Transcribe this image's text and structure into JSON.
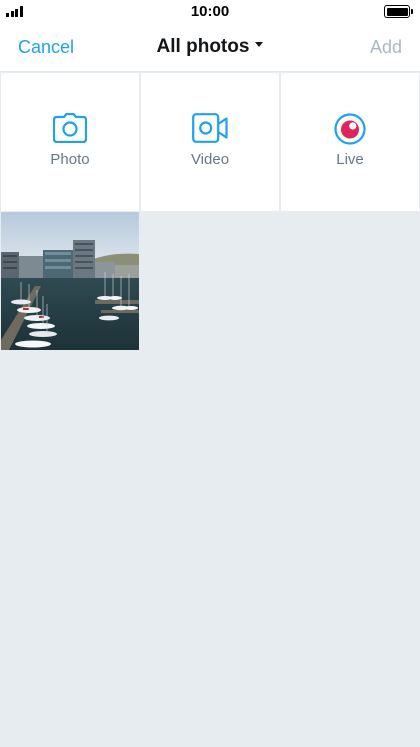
{
  "status_bar": {
    "time": "10:00"
  },
  "nav": {
    "cancel_label": "Cancel",
    "title": "All photos",
    "add_label": "Add"
  },
  "tiles": [
    {
      "label": "Photo",
      "icon": "camera-icon"
    },
    {
      "label": "Video",
      "icon": "video-camera-icon"
    },
    {
      "label": "Live",
      "icon": "periscope-live-icon"
    }
  ],
  "colors": {
    "accent": "#1da1f2",
    "disabled": "#aab8c2",
    "live": "#e0245e",
    "background": "#e6ecf0"
  }
}
